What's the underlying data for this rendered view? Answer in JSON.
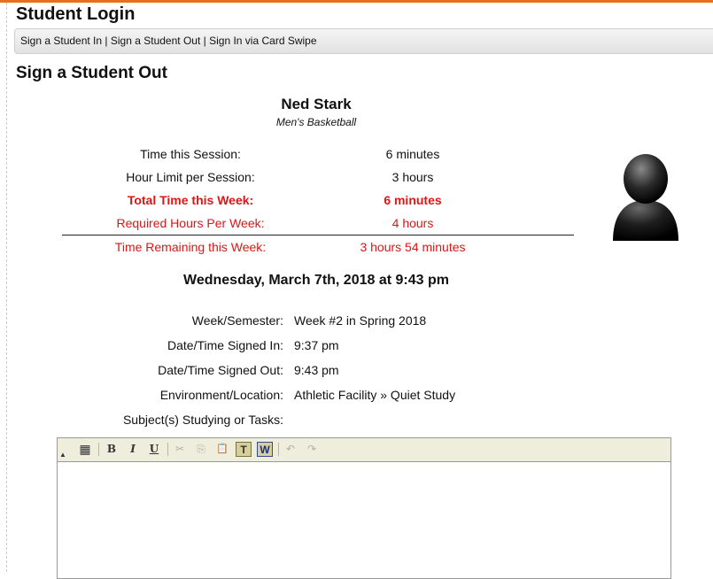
{
  "app": {
    "title": "Student Login"
  },
  "nav": {
    "sign_in": "Sign a Student In",
    "separator": "|",
    "sign_out": "Sign a Student Out",
    "card_swipe": "Sign In via Card Swipe"
  },
  "page": {
    "title": "Sign a Student Out"
  },
  "student": {
    "name": "Ned Stark",
    "team": "Men's Basketball"
  },
  "stats": [
    {
      "label": "Time this Session:",
      "value": "6 minutes"
    },
    {
      "label": "Hour Limit per Session:",
      "value": "3 hours"
    },
    {
      "label": "Total Time this Week:",
      "value": "6 minutes"
    },
    {
      "label": "Required Hours Per Week:",
      "value": "4 hours"
    },
    {
      "label": "Time Remaining this Week:",
      "value": "3 hours 54 minutes"
    }
  ],
  "current_datetime": "Wednesday, March 7th, 2018 at 9:43 pm",
  "details": [
    {
      "label": "Week/Semester:",
      "value": "Week #2 in Spring 2018"
    },
    {
      "label": "Date/Time Signed In:",
      "value": "9:37 pm"
    },
    {
      "label": "Date/Time Signed Out:",
      "value": "9:43 pm"
    },
    {
      "label": "Environment/Location:",
      "value": "Athletic Facility » Quiet Study"
    },
    {
      "label": "Subject(s) Studying or Tasks:",
      "value": ""
    }
  ],
  "editor": {
    "toolbar": {
      "collapse": "▲",
      "table": "▦",
      "bold": "B",
      "italic": "I",
      "underline": "U",
      "cut": "✂",
      "copy": "⎘",
      "paste": "📋",
      "paste_text": "T",
      "paste_word": "W",
      "undo": "↶",
      "redo": "↷"
    },
    "content": ""
  },
  "colors": {
    "accent": "#e8701a",
    "alert": "#e01515"
  }
}
